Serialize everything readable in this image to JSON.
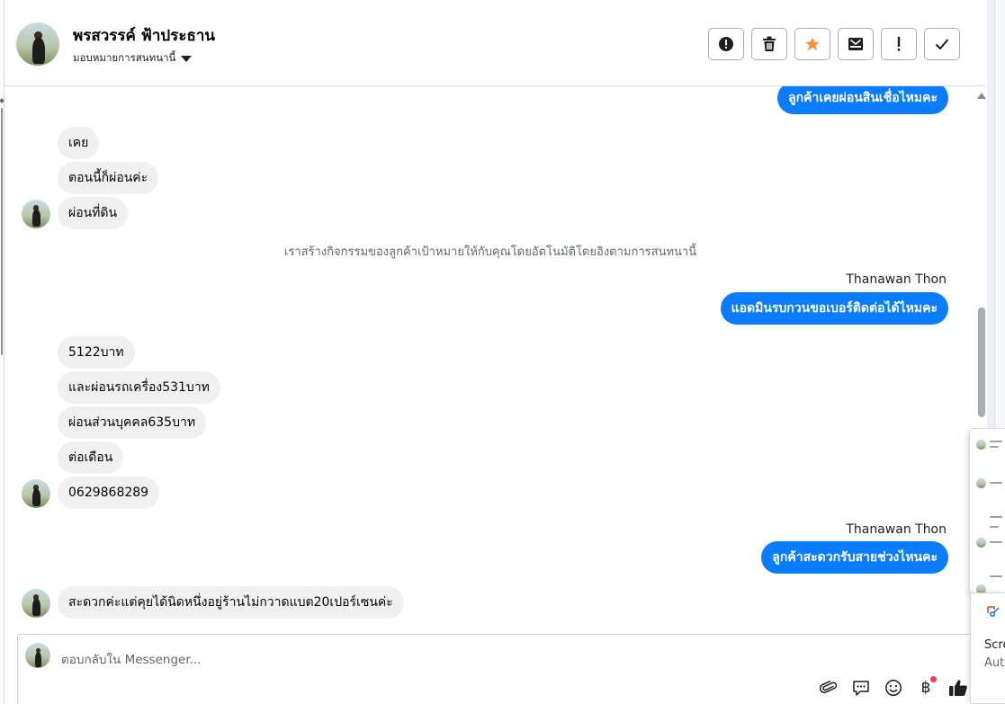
{
  "header": {
    "contact_name": "พรสวรรค์ ฟ้าประธาน",
    "assign_label": "มอบหมายการสนทนานี้",
    "actions": [
      {
        "icon": "alert-circle-icon",
        "name": "spam-button"
      },
      {
        "icon": "trash-icon",
        "name": "delete-button"
      },
      {
        "icon": "star-icon",
        "name": "star-button"
      },
      {
        "icon": "mark-unread-icon",
        "name": "mark-unread-button"
      },
      {
        "icon": "exclamation-icon",
        "name": "follow-up-button"
      },
      {
        "icon": "check-icon",
        "name": "done-button"
      }
    ],
    "star_color": "#f7923b"
  },
  "conversation": {
    "outgoing_color": "#0a7cff",
    "incoming_color": "#f0f0f0",
    "messages": [
      {
        "dir": "out",
        "text": "ลูกค้าเคยผ่อนสินเชื่อไหมคะ"
      },
      {
        "dir": "in",
        "text": "เคย"
      },
      {
        "dir": "in",
        "text": "ตอนนี้ก็ผ่อนค่ะ"
      },
      {
        "dir": "in",
        "text": "ผ่อนที่ดิน"
      },
      {
        "dir": "system",
        "text": "เราสร้างกิจกรรมของลูกค้าเป้าหมายให้กับคุณโดยอัตโนมัติโดยอิงตามการสนทนานี้"
      },
      {
        "dir": "sender",
        "text": "Thanawan Thon"
      },
      {
        "dir": "out",
        "text": "แอดมินรบกวนขอเบอร์ติดต่อได้ไหมคะ"
      },
      {
        "dir": "in",
        "text": "5122บาท"
      },
      {
        "dir": "in",
        "text": "และผ่อนรถเครื่อง531บาท"
      },
      {
        "dir": "in",
        "text": "ผ่อนส่วนบุคคล635บาท"
      },
      {
        "dir": "in",
        "text": "ต่อเดือน"
      },
      {
        "dir": "in",
        "text": "0629868289"
      },
      {
        "dir": "sender",
        "text": "Thanawan Thon"
      },
      {
        "dir": "out",
        "text": "ลูกค้าสะดวกรับสายช่วงไหนคะ"
      },
      {
        "dir": "in",
        "text": "สะดวกค่ะแต่คุยได้นิดหนึ่งอยู่ร้านไม่กวาดแบต20เปอร์เซนค่ะ"
      }
    ]
  },
  "composer": {
    "placeholder": "ตอบกลับใน Messenger...",
    "tools": [
      "paperclip-icon",
      "chat-bubble-icon",
      "smiley-icon",
      "baht-icon",
      "thumbs-up-icon"
    ],
    "baht_symbol": "฿"
  },
  "side_popup": {
    "line1": "Scre",
    "line2": "Autc"
  }
}
